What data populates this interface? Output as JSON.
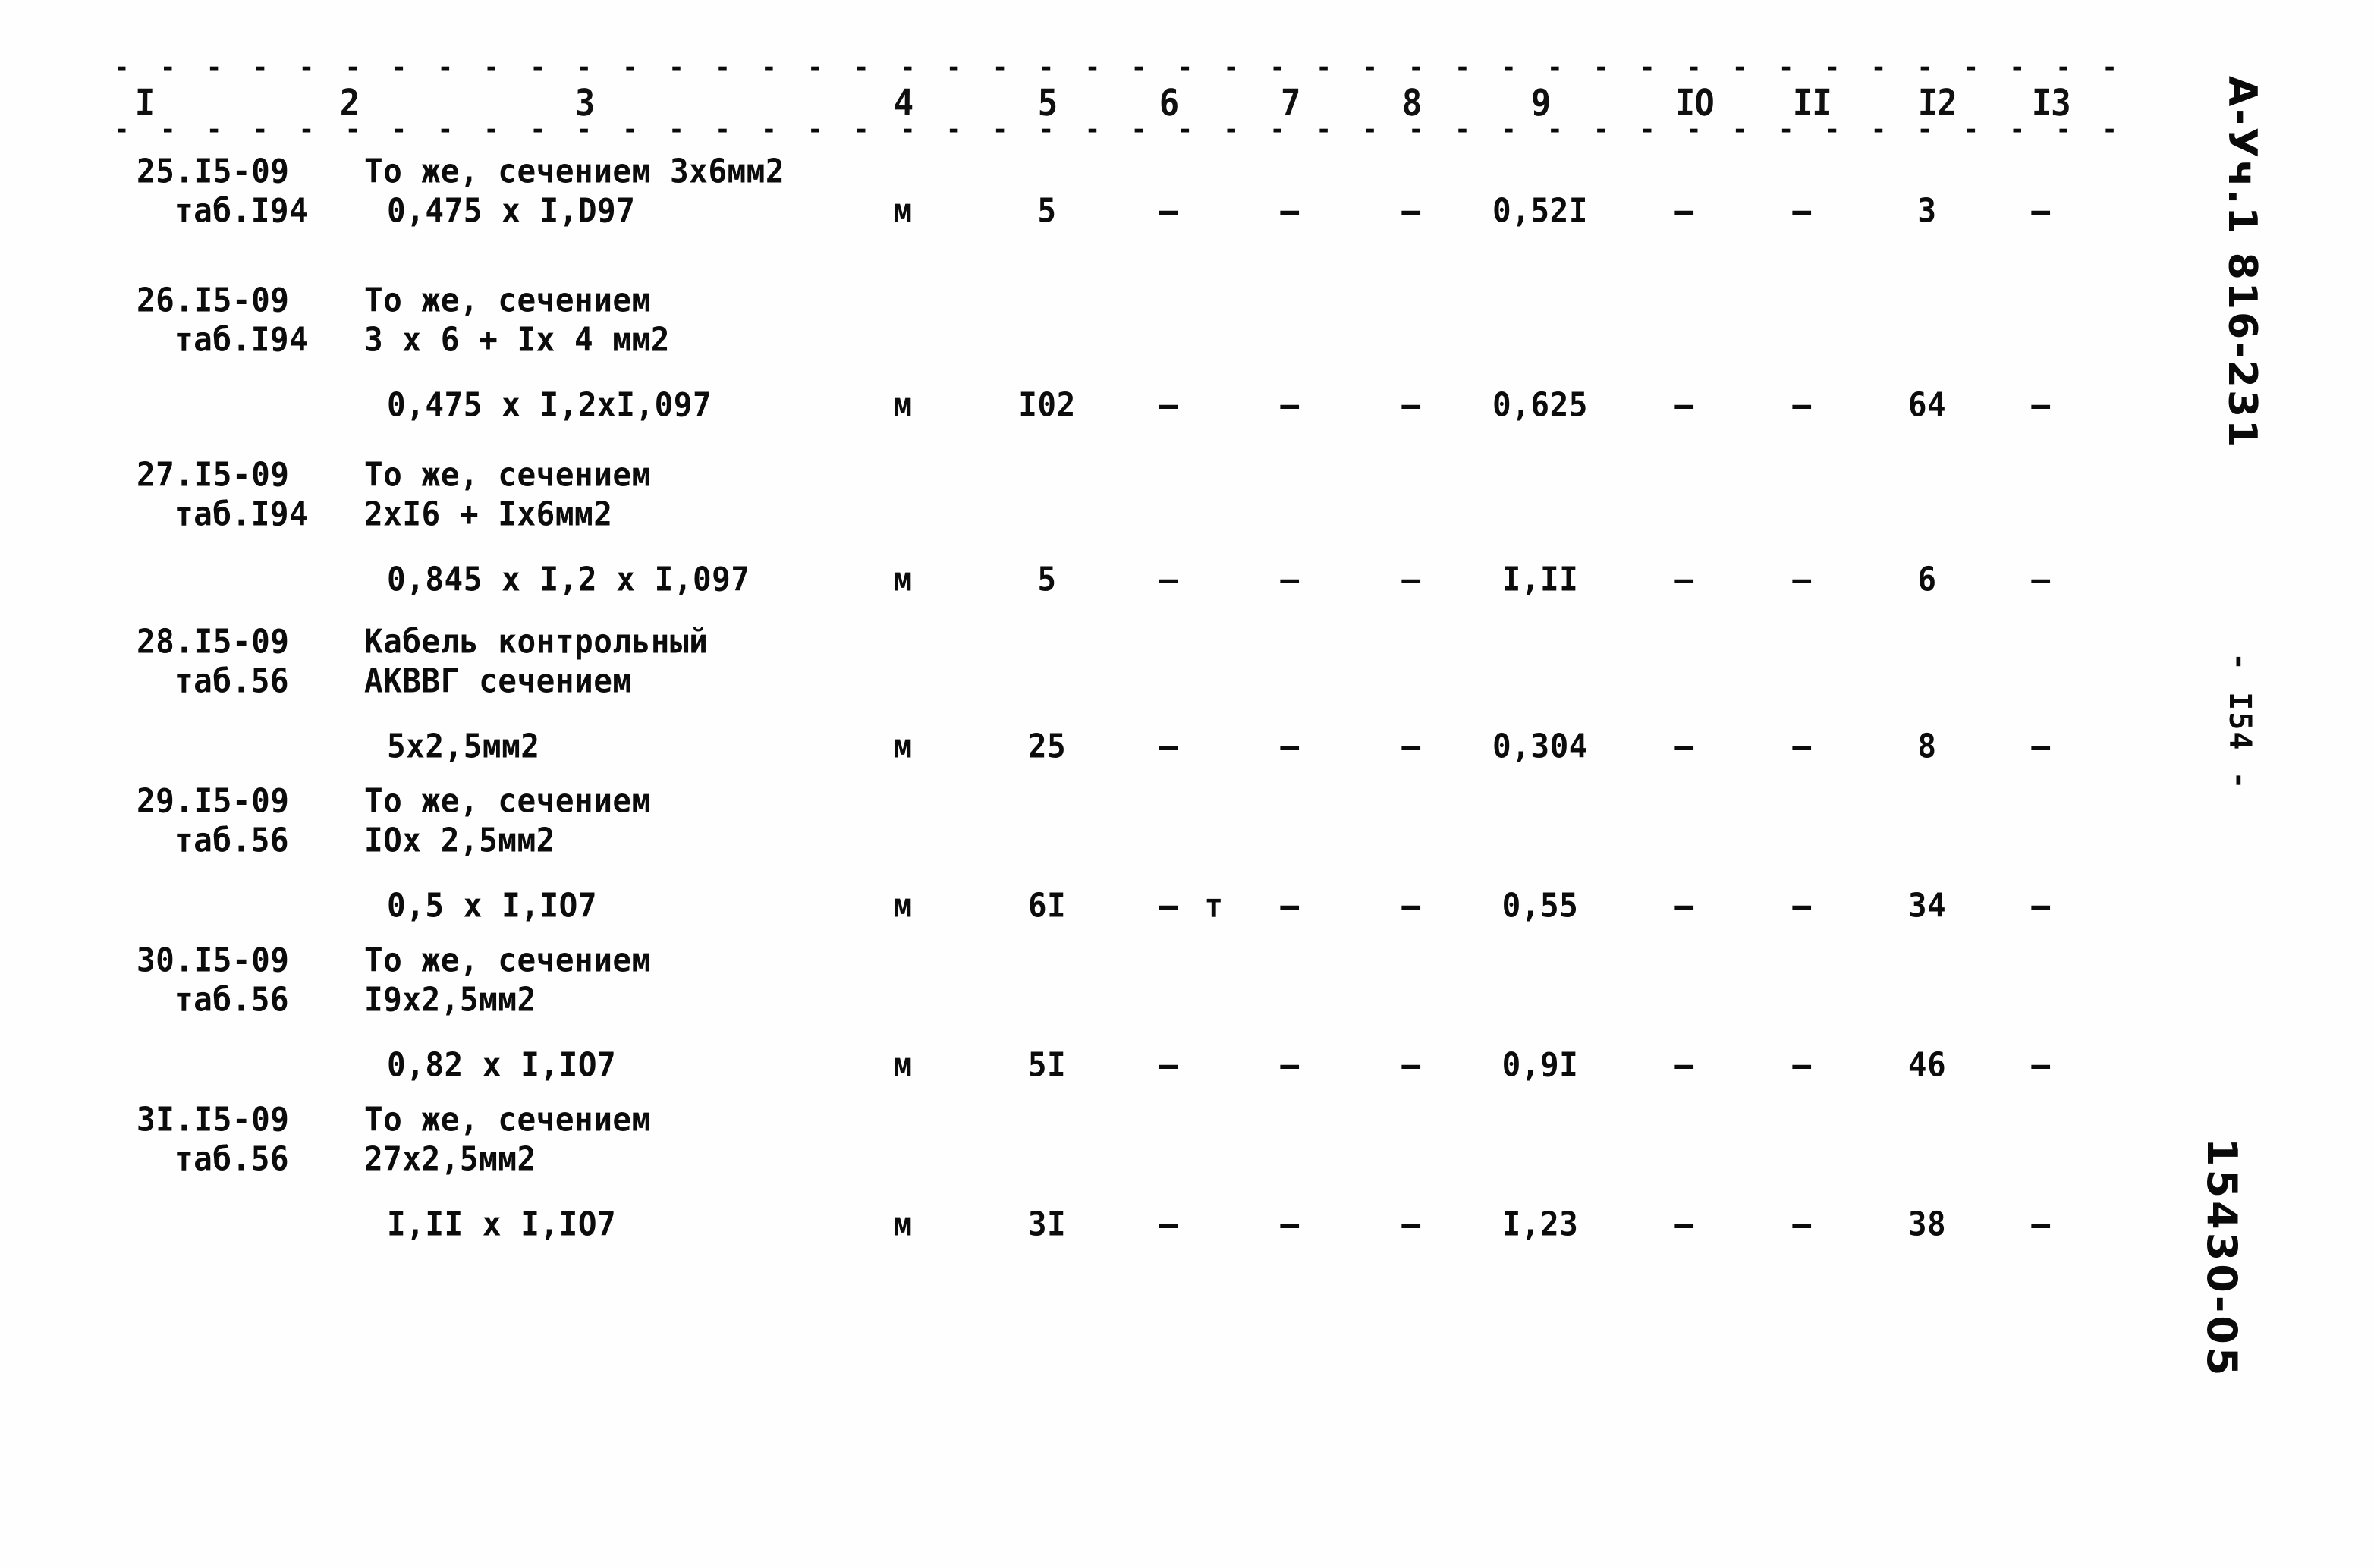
{
  "document": {
    "kind": "scanned-typewritten-estimate-table",
    "page_number_note": "- I54 -",
    "margin_code_top": "А-Уч.1 816-231",
    "margin_code_bottom": "15430-05"
  },
  "table": {
    "dash_rule": "- - - - - - - - - - - - - - - - - - - - - - - - - - - - - - - - - - - - - - - - - - - - - - -",
    "column_numbers": [
      "I",
      "2",
      "3",
      "4",
      "5",
      "6",
      "7",
      "8",
      "9",
      "IO",
      "II",
      "I2",
      "I3"
    ],
    "rows": [
      {
        "no": "25.I5-09",
        "ref": "таб.I94",
        "desc_lines": [
          "То же, сечением 3х6мм2"
        ],
        "formula": "0,475 х I,D97",
        "unit": "м",
        "qty": "5",
        "c6": "–",
        "c7": "–",
        "c8": "–",
        "c9": "0,52I",
        "c10": "–",
        "c11": "–",
        "c12": "3",
        "c13": "–",
        "stray": ""
      },
      {
        "no": "26.I5-09",
        "ref": "таб.I94",
        "desc_lines": [
          "То же, сечением",
          "3 х 6 + Iх 4 мм2"
        ],
        "formula": "0,475 х I,2хI,097",
        "unit": "м",
        "qty": "I02",
        "c6": "–",
        "c7": "–",
        "c8": "–",
        "c9": "0,625",
        "c10": "–",
        "c11": "–",
        "c12": "64",
        "c13": "–",
        "stray": ""
      },
      {
        "no": "27.I5-09",
        "ref": "таб.I94",
        "desc_lines": [
          "То же, сечением",
          "2хI6 + Iх6мм2"
        ],
        "formula": "0,845 х I,2 х I,097",
        "unit": "м",
        "qty": "5",
        "c6": "–",
        "c7": "–",
        "c8": "–",
        "c9": "I,II",
        "c10": "–",
        "c11": "–",
        "c12": "6",
        "c13": "–",
        "stray": ""
      },
      {
        "no": "28.I5-09",
        "ref": "таб.56",
        "desc_lines": [
          "Кабель контрольный",
          "АКВВГ сечением"
        ],
        "formula": "5х2,5мм2",
        "unit": "м",
        "qty": "25",
        "c6": "–",
        "c7": "–",
        "c8": "–",
        "c9": "0,304",
        "c10": "–",
        "c11": "–",
        "c12": "8",
        "c13": "–",
        "stray": ""
      },
      {
        "no": "29.I5-09",
        "ref": "таб.56",
        "desc_lines": [
          "То же, сечением",
          "IOх 2,5мм2"
        ],
        "formula": "0,5 х I,IO7",
        "unit": "м",
        "qty": "6I",
        "c6": "–",
        "c7": "–",
        "c8": "–",
        "c9": "0,55",
        "c10": "–",
        "c11": "–",
        "c12": "34",
        "c13": "–",
        "stray": "т"
      },
      {
        "no": "30.I5-09",
        "ref": "таб.56",
        "desc_lines": [
          "То же, сечением",
          "I9х2,5мм2"
        ],
        "formula": "0,82 х I,IO7",
        "unit": "м",
        "qty": "5I",
        "c6": "–",
        "c7": "–",
        "c8": "–",
        "c9": "0,9I",
        "c10": "–",
        "c11": "–",
        "c12": "46",
        "c13": "–",
        "stray": ""
      },
      {
        "no": "3I.I5-09",
        "ref": "таб.56",
        "desc_lines": [
          "То же, сечением",
          "27х2,5мм2"
        ],
        "formula": "I,II х I,IO7",
        "unit": "м",
        "qty": "3I",
        "c6": "–",
        "c7": "–",
        "c8": "–",
        "c9": "I,23",
        "c10": "–",
        "c11": "–",
        "c12": "38",
        "c13": "–",
        "stray": ""
      }
    ]
  }
}
